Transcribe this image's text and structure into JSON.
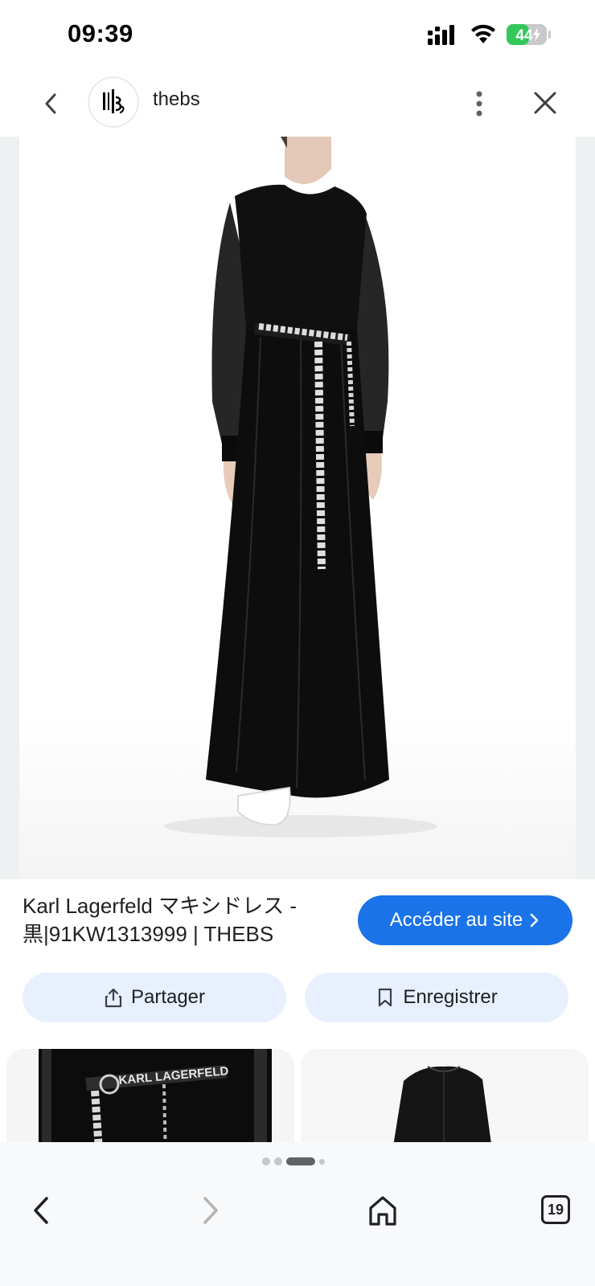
{
  "status_bar": {
    "time": "09:39",
    "battery": "44"
  },
  "header": {
    "site_name": "thebs",
    "logo_text": "TEBS"
  },
  "product": {
    "title": "Karl Lagerfeld マキシドレス - 黒|91KW1313999 | THEBS",
    "belt_text": "KARL LAGERFELD"
  },
  "actions": {
    "visit_label": "Accéder au site",
    "share_label": "Partager",
    "save_label": "Enregistrer"
  },
  "related": {
    "belt_text": "KARL LAGERFELD"
  },
  "bottom_nav": {
    "tab_count": "19"
  },
  "colors": {
    "accent": "#1a73e8",
    "pill_bg": "#e8f0fe",
    "battery_green": "#34c759"
  },
  "icons": [
    "back-icon",
    "more-icon",
    "close-icon",
    "share-icon",
    "bookmark-icon",
    "chevron-right-icon",
    "home-icon",
    "tabs-icon"
  ]
}
